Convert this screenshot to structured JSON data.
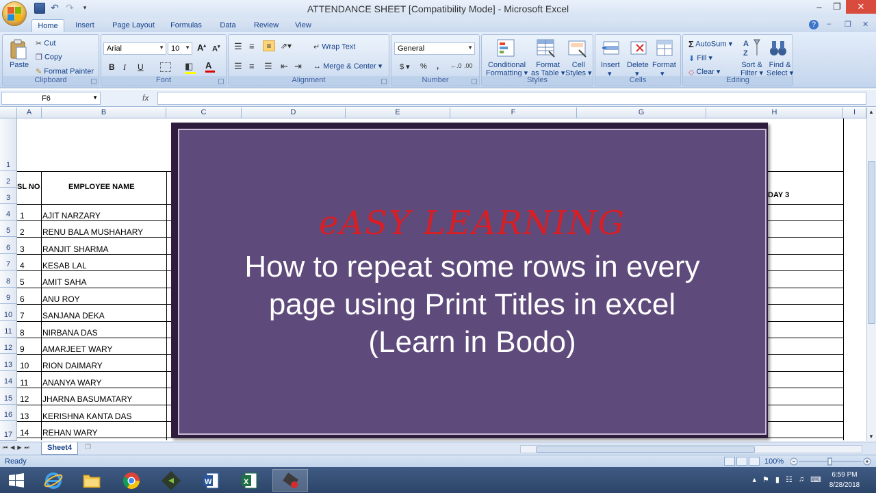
{
  "window": {
    "title": "ATTENDANCE SHEET  [Compatibility Mode] - Microsoft Excel"
  },
  "tabs": [
    "Home",
    "Insert",
    "Page Layout",
    "Formulas",
    "Data",
    "Review",
    "View"
  ],
  "ribbon": {
    "clipboard": {
      "paste": "Paste",
      "cut": "Cut",
      "copy": "Copy",
      "format_painter": "Format Painter",
      "label": "Clipboard"
    },
    "font": {
      "name": "Arial",
      "size": "10",
      "label": "Font",
      "bold": "B",
      "italic": "I",
      "underline": "U"
    },
    "alignment": {
      "wrap_text": "Wrap Text",
      "merge_center": "Merge & Center",
      "label": "Alignment"
    },
    "number": {
      "format": "General",
      "label": "Number",
      "currency": "$",
      "percent": "%",
      "comma": ","
    },
    "styles": {
      "conditional": "Conditional",
      "conditional2": "Formatting",
      "format_as": "Format",
      "format_as2": "as Table",
      "cell": "Cell",
      "cell2": "Styles",
      "label": "Styles"
    },
    "cells": {
      "insert": "Insert",
      "delete": "Delete",
      "format": "Format",
      "label": "Cells"
    },
    "editing": {
      "autosum": "AutoSum",
      "fill": "Fill",
      "clear": "Clear",
      "sort": "Sort &",
      "sort2": "Filter",
      "find": "Find &",
      "find2": "Select",
      "label": "Editing"
    }
  },
  "formula_bar": {
    "name_box": "F6",
    "fx": "fx",
    "value": ""
  },
  "columns": [
    {
      "label": "A"
    },
    {
      "label": "B"
    },
    {
      "label": "C"
    },
    {
      "label": "D"
    },
    {
      "label": "E"
    },
    {
      "label": "F"
    },
    {
      "label": "G"
    },
    {
      "label": "H"
    },
    {
      "label": "I"
    }
  ],
  "rows": [
    "1",
    "2",
    "3",
    "4",
    "5",
    "6",
    "7",
    "8",
    "9",
    "10",
    "11",
    "12",
    "13",
    "14",
    "15",
    "16",
    "17"
  ],
  "sheet": {
    "header_sl": "SL NO",
    "header_name": "EMPLOYEE NAME",
    "header_day": "DAY 3",
    "employees": [
      {
        "sl": "1",
        "name": "AJIT NARZARY"
      },
      {
        "sl": "2",
        "name": "RENU BALA MUSHAHARY"
      },
      {
        "sl": "3",
        "name": "RANJIT SHARMA"
      },
      {
        "sl": "4",
        "name": "KESAB LAL"
      },
      {
        "sl": "5",
        "name": "AMIT SAHA"
      },
      {
        "sl": "6",
        "name": "ANU ROY"
      },
      {
        "sl": "7",
        "name": "SANJANA DEKA"
      },
      {
        "sl": "8",
        "name": "NIRBANA DAS"
      },
      {
        "sl": "9",
        "name": "AMARJEET WARY"
      },
      {
        "sl": "10",
        "name": "RION DAIMARY"
      },
      {
        "sl": "11",
        "name": "ANANYA WARY"
      },
      {
        "sl": "12",
        "name": "JHARNA BASUMATARY"
      },
      {
        "sl": "13",
        "name": "KERISHNA KANTA DAS"
      },
      {
        "sl": "14",
        "name": "REHAN WARY"
      }
    ]
  },
  "overlay": {
    "title": "eASY LEARNING",
    "line1": "How to repeat some rows in every",
    "line2": "page using Print Titles in excel",
    "line3": "(Learn in Bodo)"
  },
  "sheet_tabs": [
    "Sheet4"
  ],
  "status": {
    "ready": "Ready",
    "zoom": "100%"
  },
  "taskbar": {
    "apps": [
      "start-icon",
      "internet-explorer-icon",
      "file-explorer-icon",
      "chrome-icon",
      "camtasia-icon",
      "word-icon",
      "excel-icon",
      "recorder-icon"
    ],
    "time": "6:59 PM",
    "date": "8/28/2018"
  },
  "colors": {
    "overlay_bg": "#5e4a7b",
    "overlay_title": "#d81f26",
    "ribbon": "#cddcf0",
    "taskbar": "#2c4468"
  }
}
